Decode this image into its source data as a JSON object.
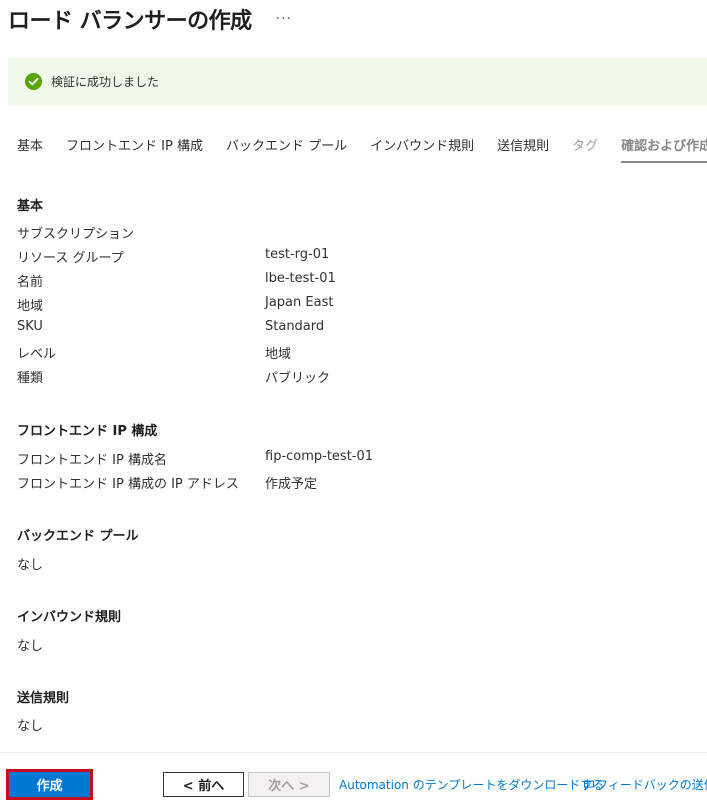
{
  "header": {
    "title": "ロード バランサーの作成",
    "more": "···"
  },
  "banner": {
    "text": "検証に成功しました",
    "icon": "check-circle-icon",
    "color": "#57a300"
  },
  "tabs": [
    {
      "label": "基本",
      "state": "normal"
    },
    {
      "label": "フロントエンド IP 構成",
      "state": "normal"
    },
    {
      "label": "バックエンド プール",
      "state": "normal"
    },
    {
      "label": "インバウンド規則",
      "state": "normal"
    },
    {
      "label": "送信規則",
      "state": "normal"
    },
    {
      "label": "タグ",
      "state": "disabled"
    },
    {
      "label": "確認および作成",
      "state": "active"
    }
  ],
  "basics": {
    "heading": "基本",
    "rows": [
      {
        "key": "サブスクリプション",
        "value": ""
      },
      {
        "key": "リソース グループ",
        "value": "test-rg-01"
      },
      {
        "key": "名前",
        "value": "lbe-test-01"
      },
      {
        "key": "地域",
        "value": "Japan East"
      },
      {
        "key": "SKU",
        "value": "Standard"
      },
      {
        "key": "レベル",
        "value": "地域"
      },
      {
        "key": "種類",
        "value": "パブリック"
      }
    ]
  },
  "frontend": {
    "heading": "フロントエンド IP 構成",
    "rows": [
      {
        "key": "フロントエンド IP 構成名",
        "value": "fip-comp-test-01"
      },
      {
        "key": "フロントエンド IP 構成の IP アドレス",
        "value": "作成予定"
      }
    ]
  },
  "backend": {
    "heading": "バックエンド プール",
    "value": "なし"
  },
  "inbound": {
    "heading": "インバウンド規則",
    "value": "なし"
  },
  "outbound": {
    "heading": "送信規則",
    "value": "なし"
  },
  "footer": {
    "create": "作成",
    "prev": "< 前へ",
    "next": "次へ >",
    "automation": "Automation のテンプレートをダウンロードする",
    "feedback": "フィードバックの送信"
  }
}
